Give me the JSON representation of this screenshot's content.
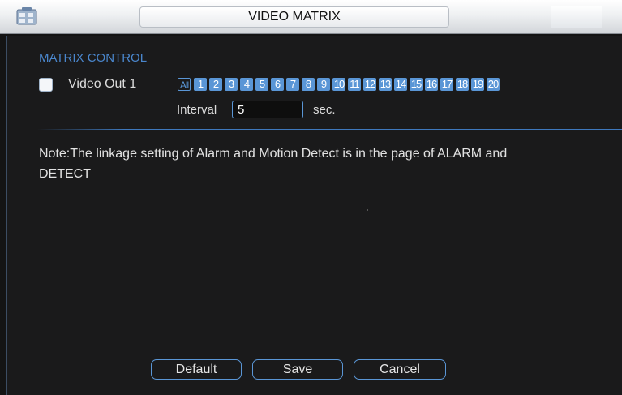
{
  "window": {
    "title": "VIDEO MATRIX"
  },
  "matrix_control": {
    "section_title": "MATRIX CONTROL",
    "video_out": {
      "label": "Video Out 1",
      "checked": false
    },
    "channels": [
      "All",
      "1",
      "2",
      "3",
      "4",
      "5",
      "6",
      "7",
      "8",
      "9",
      "10",
      "11",
      "12",
      "13",
      "14",
      "15",
      "16",
      "17",
      "18",
      "19",
      "20"
    ],
    "interval": {
      "label": "Interval",
      "value": "5",
      "unit": "sec."
    }
  },
  "note": "Note:The linkage setting of Alarm and Motion Detect is in the page of ALARM and DETECT",
  "buttons": {
    "default_label": "Default",
    "save_label": "Save",
    "cancel_label": "Cancel"
  },
  "colors": {
    "accent": "#5a96d6",
    "section_title": "#4a86cc",
    "background": "#1a1a1b"
  }
}
